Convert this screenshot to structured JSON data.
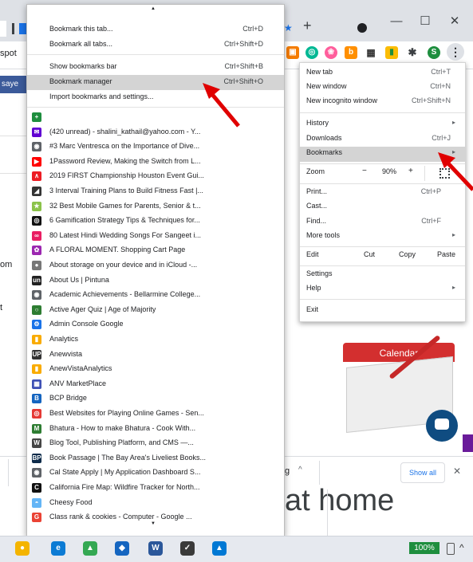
{
  "browser": {
    "new_tab_glyph": "+",
    "win_min": "—",
    "win_max": "☐",
    "win_close": "✕",
    "menu_dots": "⋮",
    "profile_initial": "S",
    "left_fragments": [
      "spot",
      "saye",
      "om",
      "t"
    ],
    "page_heading_fragment": "at home",
    "download_bar": {
      "show_all": "Show all",
      "close": "✕",
      "chevron": "^",
      "item_fragment": "g"
    },
    "calendar_label": "Calendar",
    "chat_icon": "chat-bubble-icon",
    "battery": "100%"
  },
  "chrome_menu": {
    "items": [
      {
        "label": "New tab",
        "shortcut": "Ctrl+T"
      },
      {
        "label": "New window",
        "shortcut": "Ctrl+N"
      },
      {
        "label": "New incognito window",
        "shortcut": "Ctrl+Shift+N"
      },
      {
        "label": "History",
        "arrow": "▸"
      },
      {
        "label": "Downloads",
        "shortcut": "Ctrl+J"
      },
      {
        "label": "Bookmarks",
        "arrow": "▸"
      },
      {
        "label": "Cast...",
        "shortcut": ""
      },
      {
        "label": "Find...",
        "shortcut": "Ctrl+F"
      },
      {
        "label": "More tools",
        "arrow": "▸"
      },
      {
        "label": "Settings"
      },
      {
        "label": "Help",
        "arrow": "▸"
      },
      {
        "label": "Exit"
      }
    ],
    "zoom": {
      "label": "Zoom",
      "minus": "−",
      "value": "90%",
      "plus": "+"
    },
    "print": {
      "label": "Print...",
      "shortcut": "Ctrl+P"
    },
    "edit": {
      "label": "Edit",
      "cut": "Cut",
      "copy": "Copy",
      "paste": "Paste"
    }
  },
  "bookmarks_menu": {
    "scroll_up": "▲",
    "scroll_down": "▼",
    "actions": [
      {
        "label": "Bookmark this tab...",
        "shortcut": "Ctrl+D"
      },
      {
        "label": "Bookmark all tabs...",
        "shortcut": "Ctrl+Shift+D"
      },
      {
        "label": "Show bookmarks bar",
        "shortcut": "Ctrl+Shift+B"
      },
      {
        "label": "Bookmark manager",
        "shortcut": "Ctrl+Shift+O"
      },
      {
        "label": "Import bookmarks and settings...",
        "shortcut": ""
      }
    ],
    "bookmarks": [
      {
        "label": "",
        "icon": "plus-square-icon",
        "color": "#1e8e3e",
        "glyph": "+"
      },
      {
        "label": "(420 unread) - shalini_kathail@yahoo.com - Y...",
        "icon": "mail-icon",
        "color": "#6001d2",
        "glyph": "✉"
      },
      {
        "label": "#3 Marc Ventresca on the Importance of Dive...",
        "icon": "globe-icon",
        "color": "#5f6368",
        "glyph": "◉"
      },
      {
        "label": "1Password Review, Making the Switch from L...",
        "icon": "youtube-icon",
        "color": "#ff0000",
        "glyph": "▶"
      },
      {
        "label": "2019 FIRST Championship Houston Event Gui...",
        "icon": "first-logo-icon",
        "color": "#ed1c24",
        "glyph": "∧"
      },
      {
        "label": "3 Interval Training Plans to Build Fitness Fast |...",
        "icon": "runner-icon",
        "color": "#333333",
        "glyph": "◢"
      },
      {
        "label": "32 Best Mobile Games for Parents, Senior & t...",
        "icon": "star-icon",
        "color": "#8bc34a",
        "glyph": "★"
      },
      {
        "label": "6 Gamification Strategy Tips & Techniques for...",
        "icon": "target-icon",
        "color": "#111111",
        "glyph": "◎"
      },
      {
        "label": "80 Latest Hindi Wedding Songs For Sangeet i...",
        "icon": "wedding-icon",
        "color": "#e91e63",
        "glyph": "∞"
      },
      {
        "label": "A FLORAL MOMENT. Shopping Cart Page",
        "icon": "floral-icon",
        "color": "#9c27b0",
        "glyph": "✿"
      },
      {
        "label": "About storage on your device and in iCloud -...",
        "icon": "apple-icon",
        "color": "#777777",
        "glyph": "●"
      },
      {
        "label": "About Us | Pintuna",
        "icon": "pintuna-icon",
        "color": "#222222",
        "glyph": "un"
      },
      {
        "label": "Academic Achievements - Bellarmine College...",
        "icon": "globe-icon",
        "color": "#5f6368",
        "glyph": "◉"
      },
      {
        "label": "Active Ager Quiz | Age of Majority",
        "icon": "circle-icon",
        "color": "#2e7d32",
        "glyph": "○"
      },
      {
        "label": "Admin Console Google",
        "icon": "admin-gear-icon",
        "color": "#1a73e8",
        "glyph": "⚙"
      },
      {
        "label": "Analytics",
        "icon": "analytics-icon",
        "color": "#f9ab00",
        "glyph": "▮"
      },
      {
        "label": "Anewvista",
        "icon": "up-icon",
        "color": "#333333",
        "glyph": "UP"
      },
      {
        "label": "AnewVistaAnalytics",
        "icon": "analytics-icon",
        "color": "#f9ab00",
        "glyph": "▮"
      },
      {
        "label": "ANV MarketPlace",
        "icon": "calendar-icon",
        "color": "#3f51b5",
        "glyph": "▦"
      },
      {
        "label": "BCP Bridge",
        "icon": "bridge-icon",
        "color": "#1565c0",
        "glyph": "B"
      },
      {
        "label": "Best Websites for Playing Online Games - Sen...",
        "icon": "games-icon",
        "color": "#e53935",
        "glyph": "◎"
      },
      {
        "label": "Bhatura - How to make Bhatura - Cook With...",
        "icon": "m-icon",
        "color": "#2e7d32",
        "glyph": "M"
      },
      {
        "label": "Blog Tool, Publishing Platform, and CMS —...",
        "icon": "wordpress-icon",
        "color": "#464646",
        "glyph": "W"
      },
      {
        "label": "Book Passage | The Bay Area's Liveliest Books...",
        "icon": "bp-icon",
        "color": "#0d2b4a",
        "glyph": "BP"
      },
      {
        "label": "Cal State Apply | My Application Dashboard S...",
        "icon": "globe-icon",
        "color": "#5f6368",
        "glyph": "◉"
      },
      {
        "label": "California Fire Map: Wildfire Tracker for North...",
        "icon": "c-icon",
        "color": "#111111",
        "glyph": "C"
      },
      {
        "label": "Cheesy Food",
        "icon": "cheese-icon",
        "color": "#64b5f6",
        "glyph": "◓"
      },
      {
        "label": "Class rank & cookies - Computer - Google ...",
        "icon": "google-icon",
        "color": "#ea4335",
        "glyph": "G"
      }
    ]
  },
  "taskbar": {
    "icons": [
      {
        "name": "chrome-canary-icon",
        "color": "#f4b400",
        "glyph": "●"
      },
      {
        "name": "edge-icon",
        "color": "#0c7bd4",
        "glyph": "e"
      },
      {
        "name": "google-drive-icon",
        "color": "#34a853",
        "glyph": "▲"
      },
      {
        "name": "security-shield-icon",
        "color": "#1565c0",
        "glyph": "◆"
      },
      {
        "name": "word-icon",
        "color": "#2b579a",
        "glyph": "W"
      },
      {
        "name": "todo-icon",
        "color": "#3a3a3a",
        "glyph": "✓"
      },
      {
        "name": "photos-icon",
        "color": "#0078d4",
        "glyph": "▲"
      }
    ]
  }
}
